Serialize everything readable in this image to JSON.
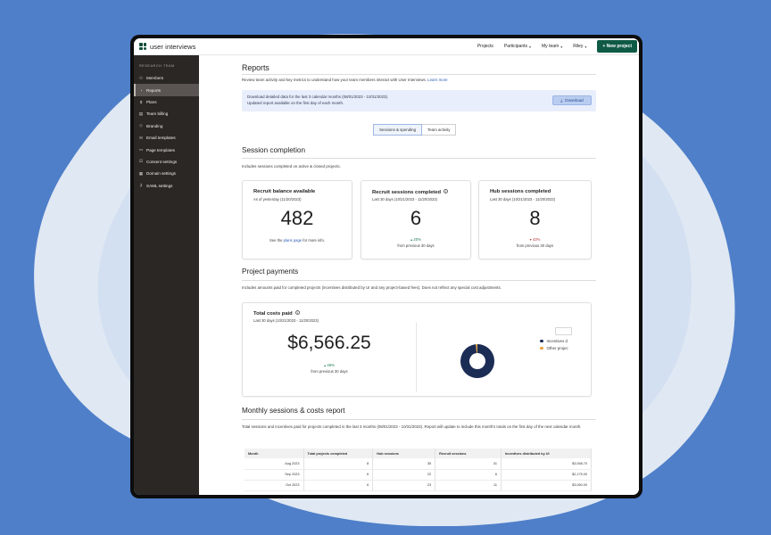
{
  "colors": {
    "background": "#4f7fc9",
    "accent": "#0f5a45",
    "sidebar": "#2a2725",
    "link": "#2b5db3",
    "positive": "#1d7a4e",
    "negative": "#b23a3a",
    "chart_primary": "#1c2d55",
    "chart_secondary": "#e8a13a"
  },
  "app": {
    "logo_text": "user interviews"
  },
  "topnav": {
    "items": [
      {
        "label": "Projects",
        "dropdown": false
      },
      {
        "label": "Participants",
        "dropdown": true
      },
      {
        "label": "My team",
        "dropdown": true
      },
      {
        "label": "Riley",
        "dropdown": true
      }
    ],
    "new_project_label": "+ New project"
  },
  "sidebar": {
    "heading": "RESEARCH TEAM",
    "items": [
      {
        "label": "Members",
        "icon": "people-icon",
        "glyph": "⚇",
        "active": false
      },
      {
        "label": "Reports",
        "icon": "reports-icon",
        "glyph": "◔",
        "active": true
      },
      {
        "label": "Plans",
        "icon": "dollar-icon",
        "glyph": "$",
        "active": false
      },
      {
        "label": "Team billing",
        "icon": "billing-icon",
        "glyph": "▤",
        "active": false
      },
      {
        "label": "Branding",
        "icon": "branding-icon",
        "glyph": "◇",
        "active": false
      },
      {
        "label": "Email templates",
        "icon": "email-icon",
        "glyph": "✉",
        "active": false
      },
      {
        "label": "Page templates",
        "icon": "page-icon",
        "glyph": "▭",
        "active": false
      },
      {
        "label": "Consent settings",
        "icon": "consent-icon",
        "glyph": "☑",
        "active": false
      },
      {
        "label": "Domain settings",
        "icon": "domain-icon",
        "glyph": "▦",
        "active": false
      },
      {
        "label": "SAML settings",
        "icon": "key-icon",
        "glyph": "⚷",
        "active": false
      }
    ]
  },
  "page": {
    "title": "Reports",
    "intro": "Review team activity and key metrics to understand how your team members interact with User Interviews.",
    "learn_more": "Learn more",
    "banner": {
      "line1": "Download detailed data for the last 3 calendar months (08/01/2023 - 10/31/2023).",
      "line2": "Updated report available on the first day of each month.",
      "download_label": "Download"
    },
    "tabs": [
      {
        "label": "Sessions & spending",
        "active": true
      },
      {
        "label": "Team activity",
        "active": false
      }
    ]
  },
  "session_completion": {
    "title": "Session completion",
    "description": "Includes sessions completed on active & closed projects.",
    "cards": [
      {
        "title": "Recruit balance available",
        "subtitle": "As of yesterday (11/20/2023)",
        "value": "482",
        "footer_pre": "See the ",
        "footer_link": "plans page",
        "footer_post": " for more info."
      },
      {
        "title": "Recruit sessions completed",
        "subtitle": "Last 30 days (10/21/2023 - 11/20/2023)",
        "value": "6",
        "change": "▴ 20%",
        "change_direction": "up",
        "change_label": "from previous 30 days"
      },
      {
        "title": "Hub sessions completed",
        "subtitle": "Last 30 days (10/21/2023 - 11/20/2023)",
        "value": "8",
        "change": "▾ 43%",
        "change_direction": "down",
        "change_label": "from previous 30 days"
      }
    ]
  },
  "project_payments": {
    "title": "Project payments",
    "description": "Includes amounts paid for completed projects (incentives distributed by UI and any project-based fees). Does not reflect any special cost adjustments.",
    "total": {
      "title": "Total costs paid",
      "subtitle": "Last 30 days (10/21/2023 - 11/20/2023)",
      "value": "$6,566.25",
      "change": "▴ 49%",
      "change_label": "from previous 30 days"
    },
    "donut": {
      "legend": [
        {
          "label": "Incentives d",
          "color": "#1c2d55"
        },
        {
          "label": "Other projec",
          "color": "#e8a13a"
        }
      ],
      "share": [
        0.985,
        0.015
      ]
    }
  },
  "monthly_report": {
    "title": "Monthly sessions & costs report",
    "description": "Total sessions and incentives paid for projects completed in the last 3 months (08/01/2023 - 10/31/2023). Report will update to include this month's totals on the first day of the next calendar month.",
    "columns": [
      "Month",
      "Total projects completed",
      "Hub sessions",
      "Recruit sessions",
      "Incentives distributed by UI"
    ],
    "rows": [
      [
        "Aug 2023",
        "8",
        "35",
        "31",
        "$3,068.70"
      ],
      [
        "Sep 2023",
        "6",
        "22",
        "6",
        "$2,175.00"
      ],
      [
        "Oct 2023",
        "6",
        "23",
        "11",
        "$3,060.00"
      ]
    ]
  }
}
